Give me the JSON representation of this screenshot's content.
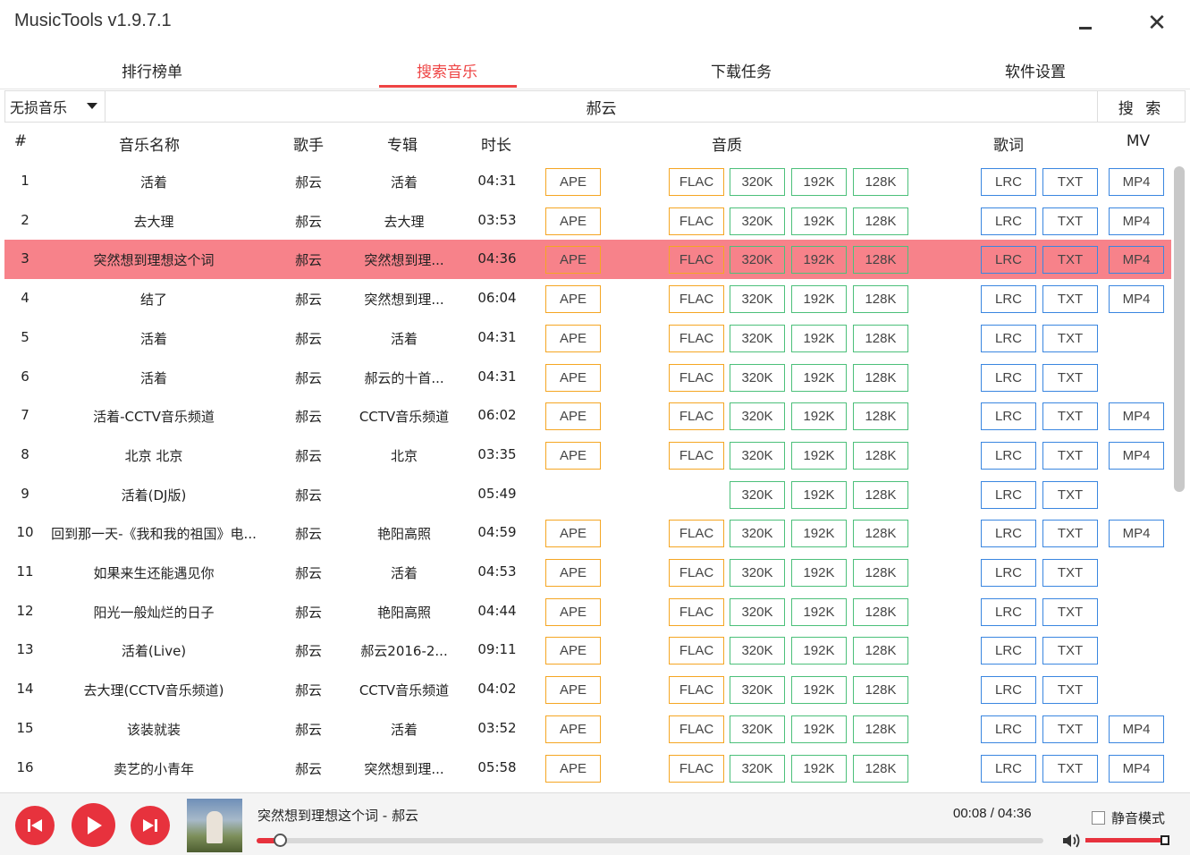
{
  "window": {
    "title": "MusicTools v1.9.7.1",
    "close_glyph": "✕"
  },
  "tabs": [
    {
      "label": "排行榜单",
      "active": false
    },
    {
      "label": "搜索音乐",
      "active": true
    },
    {
      "label": "下载任务",
      "active": false
    },
    {
      "label": "软件设置",
      "active": false
    }
  ],
  "search": {
    "source": "无损音乐",
    "query": "郝云",
    "button": "搜 索"
  },
  "headers": {
    "num": "#",
    "name": "音乐名称",
    "artist": "歌手",
    "album": "专辑",
    "duration": "时长",
    "quality": "音质",
    "lyrics": "歌词",
    "mv": "MV"
  },
  "labels": {
    "ape": "APE",
    "flac": "FLAC",
    "q320": "320K",
    "q192": "192K",
    "q128": "128K",
    "lrc": "LRC",
    "txt": "TXT",
    "mp4": "MP4"
  },
  "colors": {
    "accent": "#ee4444",
    "selected_row": "#f7828a",
    "ape_border": "#f5a623",
    "bitrate_border": "#4cc07a",
    "lyric_border": "#3a86e0"
  },
  "rows": [
    {
      "num": "1",
      "name": "活着",
      "artist": "郝云",
      "album": "活着",
      "duration": "04:31",
      "ape": true,
      "flac": true,
      "mp4": true
    },
    {
      "num": "2",
      "name": "去大理",
      "artist": "郝云",
      "album": "去大理",
      "duration": "03:53",
      "ape": true,
      "flac": true,
      "mp4": true
    },
    {
      "num": "3",
      "name": "突然想到理想这个词",
      "artist": "郝云",
      "album": "突然想到理...",
      "duration": "04:36",
      "ape": true,
      "flac": true,
      "mp4": true,
      "selected": true
    },
    {
      "num": "4",
      "name": "结了",
      "artist": "郝云",
      "album": "突然想到理...",
      "duration": "06:04",
      "ape": true,
      "flac": true,
      "mp4": true
    },
    {
      "num": "5",
      "name": "活着",
      "artist": "郝云",
      "album": "活着",
      "duration": "04:31",
      "ape": true,
      "flac": true,
      "mp4": false
    },
    {
      "num": "6",
      "name": "活着",
      "artist": "郝云",
      "album": "郝云的十首...",
      "duration": "04:31",
      "ape": true,
      "flac": true,
      "mp4": false
    },
    {
      "num": "7",
      "name": "活着-CCTV音乐频道",
      "artist": "郝云",
      "album": "CCTV音乐频道",
      "duration": "06:02",
      "ape": true,
      "flac": true,
      "mp4": true
    },
    {
      "num": "8",
      "name": "北京 北京",
      "artist": "郝云",
      "album": "北京",
      "duration": "03:35",
      "ape": true,
      "flac": true,
      "mp4": true
    },
    {
      "num": "9",
      "name": "活着(DJ版)",
      "artist": "郝云",
      "album": "",
      "duration": "05:49",
      "ape": false,
      "flac": false,
      "mp4": false
    },
    {
      "num": "10",
      "name": "回到那一天-《我和我的祖国》电...",
      "artist": "郝云",
      "album": "艳阳高照",
      "duration": "04:59",
      "ape": true,
      "flac": true,
      "mp4": true
    },
    {
      "num": "11",
      "name": "如果来生还能遇见你",
      "artist": "郝云",
      "album": "活着",
      "duration": "04:53",
      "ape": true,
      "flac": true,
      "mp4": false
    },
    {
      "num": "12",
      "name": "阳光一般灿烂的日子",
      "artist": "郝云",
      "album": "艳阳高照",
      "duration": "04:44",
      "ape": true,
      "flac": true,
      "mp4": false
    },
    {
      "num": "13",
      "name": "活着(Live)",
      "artist": "郝云",
      "album": "郝云2016-2...",
      "duration": "09:11",
      "ape": true,
      "flac": true,
      "mp4": false
    },
    {
      "num": "14",
      "name": "去大理(CCTV音乐频道)",
      "artist": "郝云",
      "album": "CCTV音乐频道",
      "duration": "04:02",
      "ape": true,
      "flac": true,
      "mp4": false
    },
    {
      "num": "15",
      "name": "该装就装",
      "artist": "郝云",
      "album": "活着",
      "duration": "03:52",
      "ape": true,
      "flac": true,
      "mp4": true
    },
    {
      "num": "16",
      "name": "卖艺的小青年",
      "artist": "郝云",
      "album": "突然想到理...",
      "duration": "05:58",
      "ape": true,
      "flac": true,
      "mp4": true
    }
  ],
  "player": {
    "track": "突然想到理想这个词 - 郝云",
    "time": "00:08 / 04:36",
    "progress": 0.029,
    "mute_label": "静音模式",
    "muted": false,
    "volume": 0.97
  }
}
